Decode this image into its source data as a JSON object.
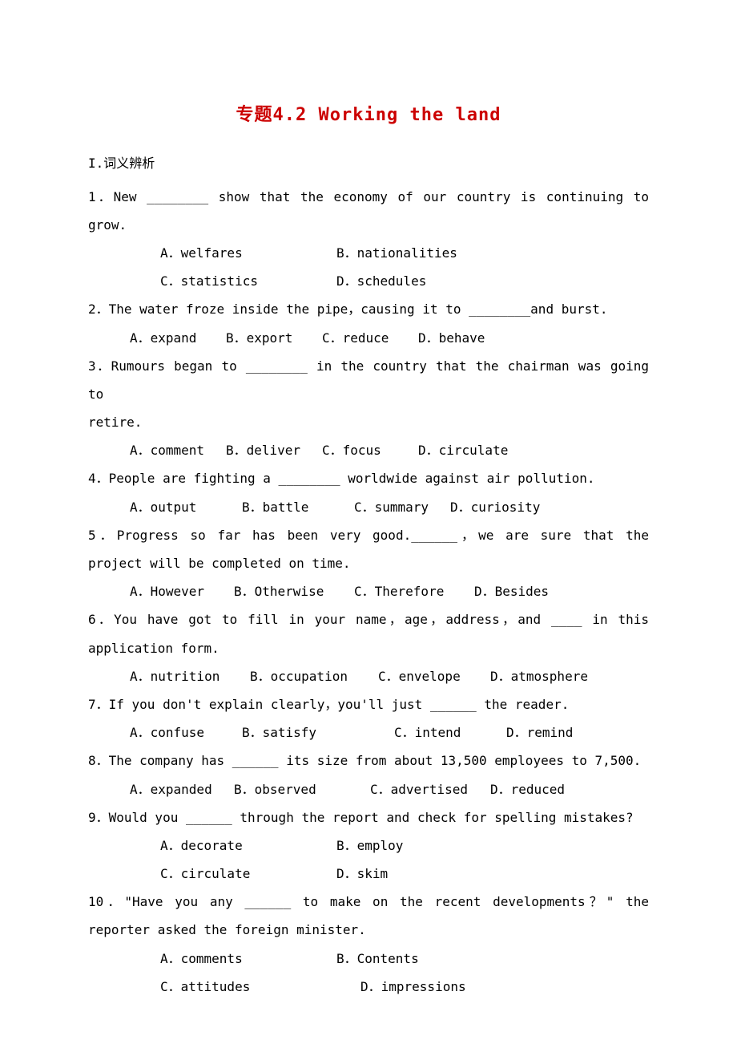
{
  "title": "专题4.2 Working the land",
  "section": "I.词义辨析",
  "q1": {
    "text": "1．New ________ show that the economy of our country is continuing to grow.",
    "a": "A．welfares",
    "b": "B．nationalities",
    "c": "C．statistics",
    "d": "D．schedules"
  },
  "q2": {
    "text": "2．The water froze inside the pipe，causing it to ________and burst.",
    "a": "A．expand",
    "b": "B．export",
    "c": "C．reduce",
    "d": "D．behave"
  },
  "q3": {
    "text": "3．Rumours began to ________ in the country that the chairman was going to retire.",
    "a": "A．comment",
    "b": "B．deliver",
    "c": "C．focus",
    "d": "D．circulate"
  },
  "q4": {
    "text": "4．People are fighting a ________ worldwide against air pollution.",
    "a": "A．output",
    "b": "B．battle",
    "c": "C．summary",
    "d": "D．curiosity"
  },
  "q5": {
    "text": "5．Progress so far has been very good.______，we are sure that the project will be completed on time.",
    "a": "A．However",
    "b": "B．Otherwise",
    "c": "C．Therefore",
    "d": "D．Besides"
  },
  "q6": {
    "text": "6．You have got to fill in your name，age，address，and ____ in this application form.",
    "a": "A．nutrition",
    "b": "B．occupation",
    "c": "C．envelope",
    "d": "D．atmosphere"
  },
  "q7": {
    "text": "7．If you don't explain clearly，you'll just ______ the reader.",
    "a": "A．confuse",
    "b": "B．satisfy",
    "c": "C．intend",
    "d": "D．remind"
  },
  "q8": {
    "text": "8．The company has ______ its size from about 13,500 employees to 7,500.",
    "a": "A．expanded",
    "b": "B．observed",
    "c": "C．advertised",
    "d": "D．reduced"
  },
  "q9": {
    "text": "9．Would you ______ through the report and check for spelling mistakes?",
    "a": "A．decorate",
    "b": "B．employ",
    "c": "C．circulate",
    "d": "D．skim"
  },
  "q10": {
    "text": "10．\"Have you any ______ to make on the recent developments？\" the reporter asked the foreign minister.",
    "a": "A．comments",
    "b": "B．Contents",
    "c": "C．attitudes",
    "d": "D．impressions"
  }
}
